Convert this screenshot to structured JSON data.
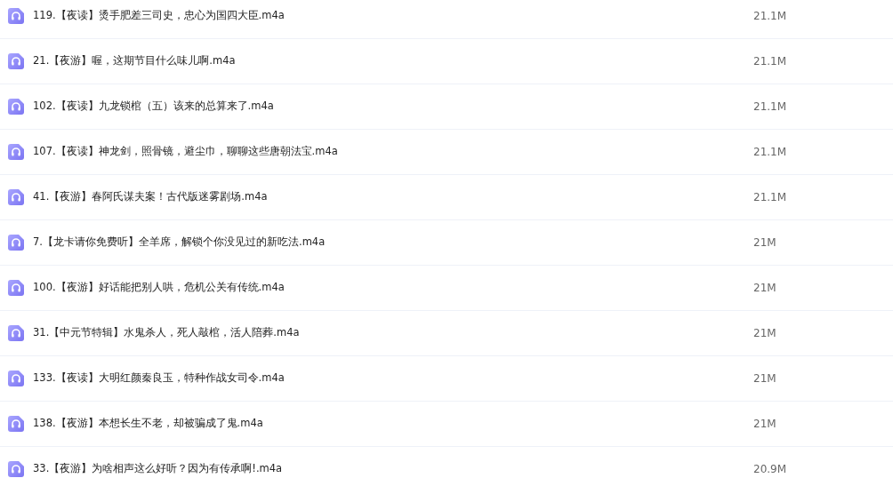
{
  "files": [
    {
      "name": "119.【夜读】烫手肥差三司史，忠心为国四大臣.m4a",
      "size": "21.1M"
    },
    {
      "name": "21.【夜游】喔，这期节目什么味儿啊.m4a",
      "size": "21.1M"
    },
    {
      "name": "102.【夜读】九龙锁棺（五）该来的总算来了.m4a",
      "size": "21.1M"
    },
    {
      "name": "107.【夜读】神龙剑，照骨镜，避尘巾，聊聊这些唐朝法宝.m4a",
      "size": "21.1M"
    },
    {
      "name": "41.【夜游】春阿氏谋夫案！古代版迷雾剧场.m4a",
      "size": "21.1M"
    },
    {
      "name": "7.【龙卡请你免费听】全羊席，解锁个你没见过的新吃法.m4a",
      "size": "21M"
    },
    {
      "name": "100.【夜游】好话能把别人哄，危机公关有传统.m4a",
      "size": "21M"
    },
    {
      "name": "31.【中元节特辑】水鬼杀人，死人敲棺，活人陪葬.m4a",
      "size": "21M"
    },
    {
      "name": "133.【夜读】大明红颜秦良玉，特种作战女司令.m4a",
      "size": "21M"
    },
    {
      "name": "138.【夜游】本想长生不老，却被骗成了鬼.m4a",
      "size": "21M"
    },
    {
      "name": "33.【夜游】为啥相声这么好听？因为有传承啊!.m4a",
      "size": "20.9M"
    }
  ]
}
